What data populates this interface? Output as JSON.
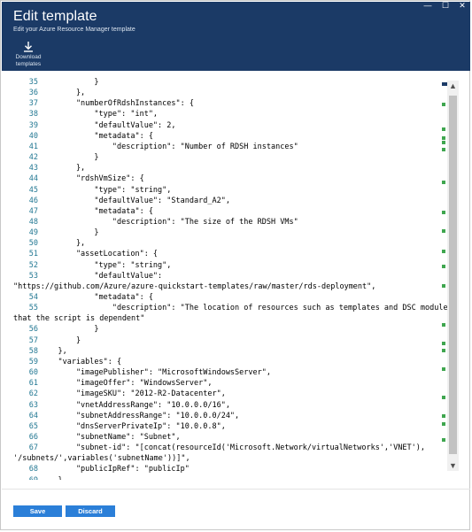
{
  "window": {
    "title": "Edit template",
    "subtitle": "Edit your Azure Resource Manager template",
    "controls": [
      "—",
      "☐",
      "✕"
    ]
  },
  "toolbar": {
    "download_label_line1": "Download",
    "download_label_line2": "templates",
    "download_icon": "download-icon"
  },
  "editor": {
    "lines": [
      {
        "n": "35",
        "t": "            }"
      },
      {
        "n": "36",
        "t": "        },"
      },
      {
        "n": "37",
        "t": "        \"numberOfRdshInstances\": {"
      },
      {
        "n": "38",
        "t": "            \"type\": \"int\","
      },
      {
        "n": "39",
        "t": "            \"defaultValue\": 2,"
      },
      {
        "n": "40",
        "t": "            \"metadata\": {"
      },
      {
        "n": "41",
        "t": "                \"description\": \"Number of RDSH instances\""
      },
      {
        "n": "42",
        "t": "            }"
      },
      {
        "n": "43",
        "t": "        },"
      },
      {
        "n": "44",
        "t": "        \"rdshVmSize\": {"
      },
      {
        "n": "45",
        "t": "            \"type\": \"string\","
      },
      {
        "n": "46",
        "t": "            \"defaultValue\": \"Standard_A2\","
      },
      {
        "n": "47",
        "t": "            \"metadata\": {"
      },
      {
        "n": "48",
        "t": "                \"description\": \"The size of the RDSH VMs\""
      },
      {
        "n": "49",
        "t": "            }"
      },
      {
        "n": "50",
        "t": "        },"
      },
      {
        "n": "51",
        "t": "        \"assetLocation\": {"
      },
      {
        "n": "52",
        "t": "            \"type\": \"string\","
      },
      {
        "n": "53",
        "t": "            \"defaultValue\":"
      },
      {
        "n": "",
        "t": "\"https://github.com/Azure/azure-quickstart-templates/raw/master/rds-deployment\","
      },
      {
        "n": "54",
        "t": "            \"metadata\": {"
      },
      {
        "n": "55",
        "t": "                \"description\": \"The location of resources such as templates and DSC modules"
      },
      {
        "n": "",
        "t": "that the script is dependent\""
      },
      {
        "n": "56",
        "t": "            }"
      },
      {
        "n": "57",
        "t": "        }"
      },
      {
        "n": "58",
        "t": "    },"
      },
      {
        "n": "59",
        "t": "    \"variables\": {"
      },
      {
        "n": "60",
        "t": "        \"imagePublisher\": \"MicrosoftWindowsServer\","
      },
      {
        "n": "61",
        "t": "        \"imageOffer\": \"WindowsServer\","
      },
      {
        "n": "62",
        "t": "        \"imageSKU\": \"2012-R2-Datacenter\","
      },
      {
        "n": "63",
        "t": "        \"vnetAddressRange\": \"10.0.0.0/16\","
      },
      {
        "n": "64",
        "t": "        \"subnetAddressRange\": \"10.0.0.0/24\","
      },
      {
        "n": "65",
        "t": "        \"dnsServerPrivateIp\": \"10.0.0.8\","
      },
      {
        "n": "66",
        "t": "        \"subnetName\": \"Subnet\","
      },
      {
        "n": "67",
        "t": "        \"subnet-id\": \"[concat(resourceId('Microsoft.Network/virtualNetworks','VNET'),"
      },
      {
        "n": "",
        "t": "'/subnets/',variables('subnetName'))]\","
      },
      {
        "n": "68",
        "t": "        \"publicIpRef\": \"publicIp\""
      },
      {
        "n": "69",
        "t": "    },"
      }
    ]
  },
  "scrollbar": {
    "up": "▲",
    "down": "▼"
  },
  "footer": {
    "save_label": "Save",
    "discard_label": "Discard"
  },
  "colors": {
    "header_bg": "#1b3a66",
    "button_bg": "#2b7fd8",
    "line_number": "#237893",
    "minimap_mark": "#3fa64f"
  }
}
